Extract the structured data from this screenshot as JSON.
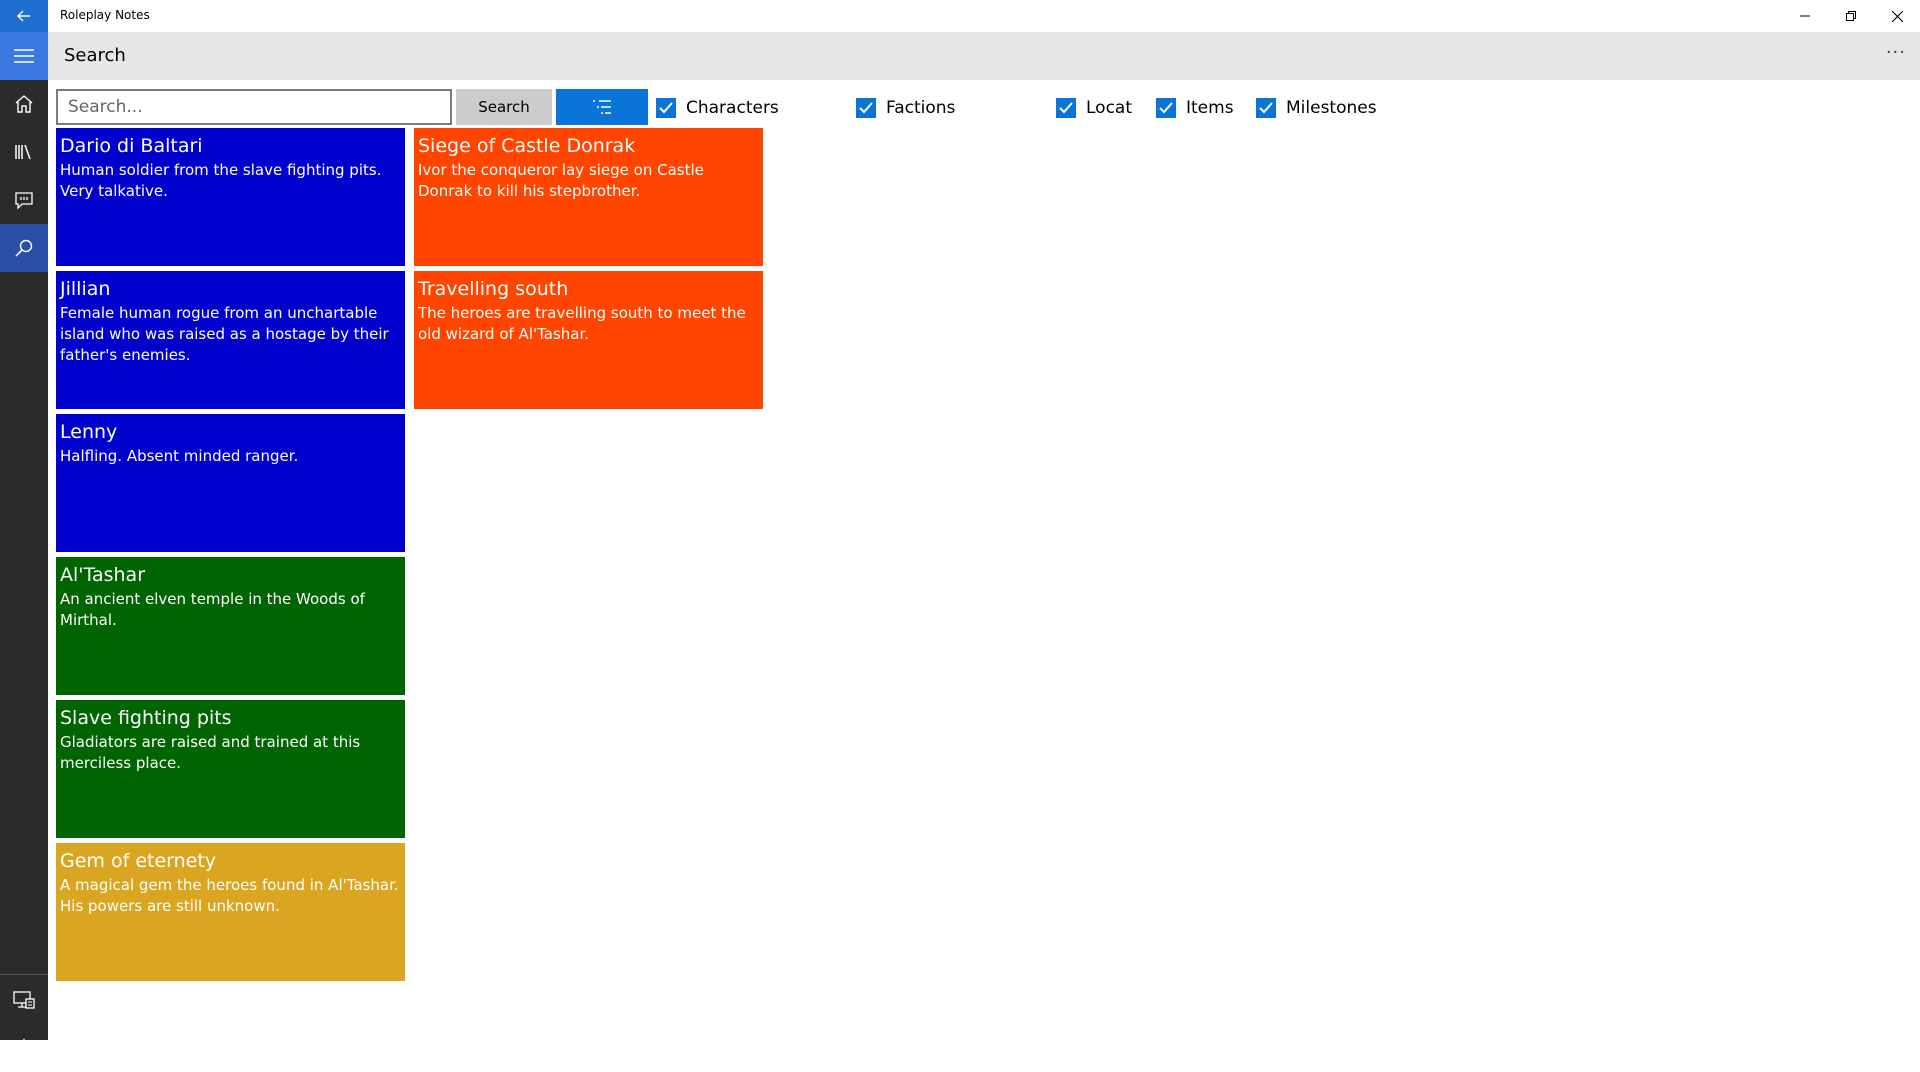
{
  "app": {
    "title": "Roleplay Notes"
  },
  "window_controls": [
    "minimize",
    "restore",
    "close"
  ],
  "nav": {
    "items": [
      {
        "name": "menu",
        "icon": "hamburger-icon"
      },
      {
        "name": "home",
        "icon": "home-icon"
      },
      {
        "name": "library",
        "icon": "library-icon"
      },
      {
        "name": "notes",
        "icon": "message-icon"
      },
      {
        "name": "search",
        "icon": "search-icon",
        "active": true
      }
    ],
    "bottom": [
      {
        "name": "campaign",
        "icon": "device-icon"
      },
      {
        "name": "settings",
        "icon": "gear-icon"
      }
    ]
  },
  "header": {
    "title": "Search",
    "more": "···"
  },
  "toolbar": {
    "search_placeholder": "Search...",
    "search_value": "",
    "search_button": "Search",
    "filters": [
      {
        "label": "Characters",
        "checked": true
      },
      {
        "label": "Factions",
        "checked": true
      },
      {
        "label": "Locat",
        "checked": true
      },
      {
        "label": "Items",
        "checked": true
      },
      {
        "label": "Milestones",
        "checked": true
      }
    ]
  },
  "colors": {
    "character": "#0000cc",
    "location": "#006400",
    "item": "#daa520",
    "milestone": "#ff4500",
    "accent": "#0b74d9"
  },
  "results": [
    {
      "kind": "character",
      "title": "Dario di Baltari",
      "description": "Human soldier from the slave fighting pits. Very talkative."
    },
    {
      "kind": "milestone",
      "title": "Siege of Castle Donrak",
      "description": "Ivor the conqueror lay siege on Castle Donrak to kill his stepbrother."
    },
    {
      "kind": "character",
      "title": "Jillian",
      "description": "Female human rogue from an unchartable island who was raised as a hostage by their father's enemies."
    },
    {
      "kind": "milestone",
      "title": "Travelling south",
      "description": "The heroes are travelling south to meet the old wizard of Al'Tashar."
    },
    {
      "kind": "character",
      "title": "Lenny",
      "description": "Halfling. Absent minded ranger."
    },
    {
      "kind": "location",
      "title": "Al'Tashar",
      "description": "An ancient elven temple in the Woods of Mirthal."
    },
    {
      "kind": "location",
      "title": "Slave fighting pits",
      "description": "Gladiators are raised and trained at this merciless place."
    },
    {
      "kind": "item",
      "title": "Gem of eternety",
      "description": "A magical gem the heroes found in Al'Tashar. His powers are still unknown."
    }
  ]
}
